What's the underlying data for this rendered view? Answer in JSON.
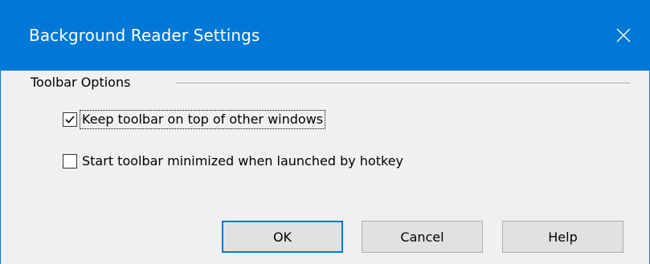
{
  "window": {
    "title": "Background Reader Settings",
    "close_glyph": "✕",
    "accent_color": "#0078d7"
  },
  "group": {
    "label": "Toolbar Options"
  },
  "options": [
    {
      "label": "Keep toolbar on top of other windows",
      "checked": true
    },
    {
      "label": "Start toolbar minimized when launched by hotkey",
      "checked": false
    }
  ],
  "buttons": {
    "ok": "OK",
    "cancel": "Cancel",
    "help": "Help"
  }
}
